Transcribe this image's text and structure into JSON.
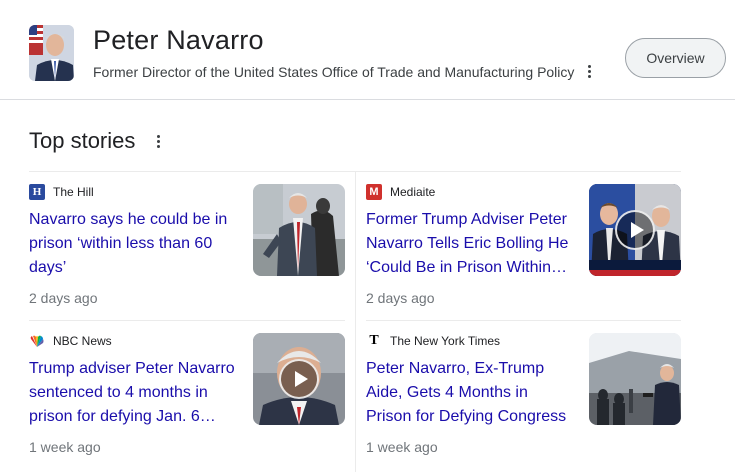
{
  "entity": {
    "name": "Peter Navarro",
    "description": "Former Director of the United States Office of Trade and Manufacturing Policy",
    "overview_label": "Overview"
  },
  "top_stories": {
    "title": "Top stories",
    "stories": [
      {
        "source": "The Hill",
        "source_logo": "H",
        "source_color": "#2a4a9e",
        "headline": "Navarro says he could be in prison ‘within less than 60 days’",
        "age": "2 days ago",
        "has_video": false,
        "thumb_icon": "navarro-outdoor-photo"
      },
      {
        "source": "Mediaite",
        "source_logo": "M",
        "source_color": "#d0312d",
        "headline": "Former Trump Adviser Peter Navarro Tells Eric Bolling He ‘Could Be in Prison Within…",
        "age": "2 days ago",
        "has_video": true,
        "thumb_icon": "tv-interview-video"
      },
      {
        "source": "NBC News",
        "source_logo": "nbc-peacock",
        "source_color": "#ffffff",
        "headline": "Trump adviser Peter Navarro sentenced to 4 months in prison for defying Jan. 6…",
        "age": "1 week ago",
        "has_video": true,
        "thumb_icon": "navarro-portrait-video"
      },
      {
        "source": "The New York Times",
        "source_logo": "T",
        "source_color": "#000000",
        "headline": "Peter Navarro, Ex-Trump Aide, Gets 4 Months in Prison for Defying Congress",
        "age": "1 week ago",
        "has_video": false,
        "thumb_icon": "press-outside-courthouse-photo"
      }
    ]
  }
}
